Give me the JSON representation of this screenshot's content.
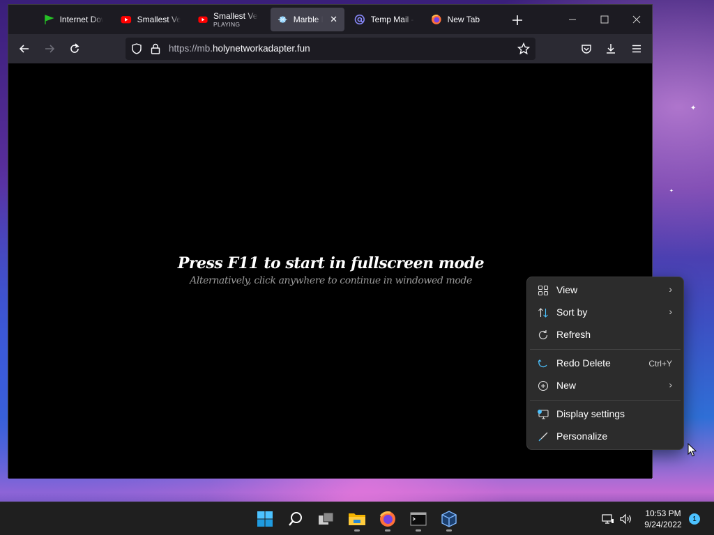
{
  "browser": {
    "tabs": [
      {
        "title": "Internet Dow",
        "icon": "idm-icon",
        "subtitle": ""
      },
      {
        "title": "Smallest Vers",
        "icon": "youtube-icon",
        "subtitle": ""
      },
      {
        "title": "Smallest Vers",
        "icon": "youtube-icon",
        "subtitle": "PLAYING"
      },
      {
        "title": "Marble Bl",
        "icon": "marble-icon",
        "subtitle": "",
        "active": true
      },
      {
        "title": "Temp Mail - I",
        "icon": "tempmail-icon",
        "subtitle": ""
      },
      {
        "title": "New Tab",
        "icon": "firefox-icon",
        "subtitle": ""
      }
    ],
    "url": {
      "prefix": "https://mb.",
      "domain": "holynetworkadapter.fun"
    }
  },
  "page": {
    "main_message": "Press F11 to start in fullscreen mode",
    "sub_message": "Alternatively, click anywhere to continue in windowed mode"
  },
  "context_menu": {
    "items": [
      {
        "label": "View",
        "submenu": true
      },
      {
        "label": "Sort by",
        "submenu": true
      },
      {
        "label": "Refresh"
      },
      {
        "label": "Redo Delete",
        "shortcut": "Ctrl+Y"
      },
      {
        "label": "New",
        "submenu": true
      },
      {
        "label": "Display settings"
      },
      {
        "label": "Personalize"
      }
    ]
  },
  "taskbar": {
    "time": "10:53 PM",
    "date": "9/24/2022",
    "notifications": "1"
  },
  "colors": {
    "accent": "#4cc2ff",
    "menu_bg": "#2c2c2c",
    "tab_bg": "#1c1b22"
  }
}
